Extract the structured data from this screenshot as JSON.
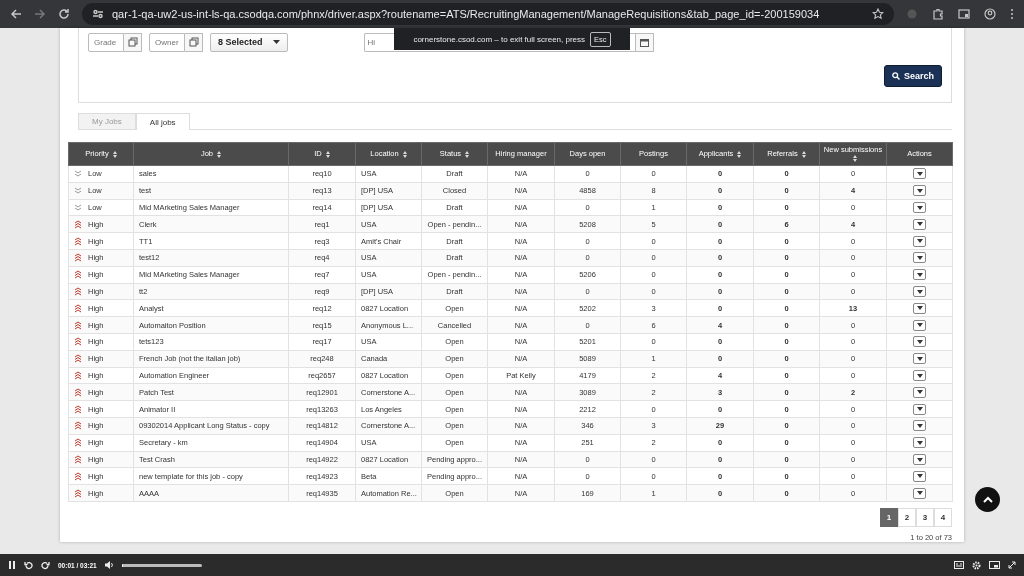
{
  "browser": {
    "url": "qar-1-qa-uw2-us-int-ls-qa.csodqa.com/phnx/driver.aspx?routename=ATS/RecruitingManagement/ManageRequisitions&tab_page_id=-200159034"
  },
  "fullscreen_notice": {
    "text": "cornerstone.csod.com – to exit full screen, press",
    "key": "Esc"
  },
  "filters": {
    "grade": {
      "placeholder": "Grade"
    },
    "owner": {
      "placeholder": "Owner"
    },
    "status_dropdown": "8 Selected",
    "hiring_field": {
      "placeholder": "Hi"
    },
    "search_button": "Search"
  },
  "tabs": [
    {
      "label": "My Jobs",
      "selected": false
    },
    {
      "label": "All jobs",
      "selected": true
    }
  ],
  "table": {
    "columns": [
      {
        "label": "Priority",
        "sortable": true
      },
      {
        "label": "Job",
        "sortable": true
      },
      {
        "label": "ID",
        "sortable": true
      },
      {
        "label": "Location",
        "sortable": true
      },
      {
        "label": "Status",
        "sortable": true
      },
      {
        "label": "Hiring manager",
        "sortable": false
      },
      {
        "label": "Days open",
        "sortable": false
      },
      {
        "label": "Postings",
        "sortable": false
      },
      {
        "label": "Applicants",
        "sortable": true
      },
      {
        "label": "Referrals",
        "sortable": true
      },
      {
        "label": "New submissions",
        "sortable": true
      },
      {
        "label": "Actions",
        "sortable": false
      }
    ],
    "rows": [
      {
        "priority": "Low",
        "kind": "low",
        "job": "sales",
        "id": "req10",
        "location": "USA",
        "status": "Draft",
        "hiring_manager": "N/A",
        "days_open": "0",
        "postings": "0",
        "applicants": "0",
        "referrals": "0",
        "new_submissions": "0",
        "new_submissions_bold": false
      },
      {
        "priority": "Low",
        "kind": "low",
        "job": "test",
        "id": "req13",
        "location": "[DP] USA",
        "status": "Closed",
        "hiring_manager": "N/A",
        "days_open": "4858",
        "postings": "8",
        "applicants": "0",
        "referrals": "0",
        "new_submissions": "4",
        "new_submissions_bold": true
      },
      {
        "priority": "Low",
        "kind": "low",
        "job": "Mid MArketing Sales Manager",
        "id": "req14",
        "location": "[DP] USA",
        "status": "Draft",
        "hiring_manager": "N/A",
        "days_open": "0",
        "postings": "1",
        "applicants": "0",
        "referrals": "0",
        "new_submissions": "0",
        "new_submissions_bold": false
      },
      {
        "priority": "High",
        "kind": "high",
        "job": "Clerk",
        "id": "req1",
        "location": "USA",
        "status": "Open - pendin...",
        "hiring_manager": "N/A",
        "days_open": "5208",
        "postings": "5",
        "applicants": "0",
        "referrals": "6",
        "new_submissions": "4",
        "new_submissions_bold": true
      },
      {
        "priority": "High",
        "kind": "high",
        "job": "TT1",
        "id": "req3",
        "location": "Amit's Chair",
        "status": "Draft",
        "hiring_manager": "N/A",
        "days_open": "0",
        "postings": "0",
        "applicants": "0",
        "referrals": "0",
        "new_submissions": "0",
        "new_submissions_bold": false
      },
      {
        "priority": "High",
        "kind": "high",
        "job": "test12",
        "id": "req4",
        "location": "USA",
        "status": "Draft",
        "hiring_manager": "N/A",
        "days_open": "0",
        "postings": "0",
        "applicants": "0",
        "referrals": "0",
        "new_submissions": "0",
        "new_submissions_bold": false
      },
      {
        "priority": "High",
        "kind": "high",
        "job": "Mid MArketing Sales Manager",
        "id": "req7",
        "location": "USA",
        "status": "Open - pendin...",
        "hiring_manager": "N/A",
        "days_open": "5206",
        "postings": "0",
        "applicants": "0",
        "referrals": "0",
        "new_submissions": "0",
        "new_submissions_bold": false
      },
      {
        "priority": "High",
        "kind": "high",
        "job": "tt2",
        "id": "req9",
        "location": "[DP] USA",
        "status": "Draft",
        "hiring_manager": "N/A",
        "days_open": "0",
        "postings": "0",
        "applicants": "0",
        "referrals": "0",
        "new_submissions": "0",
        "new_submissions_bold": false
      },
      {
        "priority": "High",
        "kind": "high",
        "job": "Analyst",
        "id": "req12",
        "location": "0827 Location",
        "status": "Open",
        "hiring_manager": "N/A",
        "days_open": "5202",
        "postings": "3",
        "applicants": "0",
        "referrals": "0",
        "new_submissions": "13",
        "new_submissions_bold": true
      },
      {
        "priority": "High",
        "kind": "high",
        "job": "Automaiton Position",
        "id": "req15",
        "location": "Anonymous L...",
        "status": "Cancelled",
        "hiring_manager": "N/A",
        "days_open": "0",
        "postings": "6",
        "applicants": "4",
        "referrals": "0",
        "new_submissions": "0",
        "new_submissions_bold": false
      },
      {
        "priority": "High",
        "kind": "high",
        "job": "tets123",
        "id": "req17",
        "location": "USA",
        "status": "Open",
        "hiring_manager": "N/A",
        "days_open": "5201",
        "postings": "0",
        "applicants": "0",
        "referrals": "0",
        "new_submissions": "0",
        "new_submissions_bold": false
      },
      {
        "priority": "High",
        "kind": "high",
        "job": "French Job (not the italian job)",
        "id": "req248",
        "location": "Canada",
        "status": "Open",
        "hiring_manager": "N/A",
        "days_open": "5089",
        "postings": "1",
        "applicants": "0",
        "referrals": "0",
        "new_submissions": "0",
        "new_submissions_bold": false
      },
      {
        "priority": "High",
        "kind": "high",
        "job": "Automation Engineer",
        "id": "req2657",
        "location": "0827 Location",
        "status": "Open",
        "hiring_manager": "Pat Kelly",
        "days_open": "4179",
        "postings": "2",
        "applicants": "4",
        "referrals": "0",
        "new_submissions": "0",
        "new_submissions_bold": false
      },
      {
        "priority": "High",
        "kind": "high",
        "job": "Patch Test",
        "id": "req12901",
        "location": "Cornerstone A...",
        "status": "Open",
        "hiring_manager": "N/A",
        "days_open": "3089",
        "postings": "2",
        "applicants": "3",
        "referrals": "0",
        "new_submissions": "2",
        "new_submissions_bold": true
      },
      {
        "priority": "High",
        "kind": "high",
        "job": "Animator II",
        "id": "req13263",
        "location": "Los Angeles",
        "status": "Open",
        "hiring_manager": "N/A",
        "days_open": "2212",
        "postings": "0",
        "applicants": "0",
        "referrals": "0",
        "new_submissions": "0",
        "new_submissions_bold": false
      },
      {
        "priority": "High",
        "kind": "high",
        "job": "09302014 Applicant Long Status - copy",
        "id": "req14812",
        "location": "Cornerstone A...",
        "status": "Open",
        "hiring_manager": "N/A",
        "days_open": "346",
        "postings": "3",
        "applicants": "29",
        "referrals": "0",
        "new_submissions": "0",
        "new_submissions_bold": false
      },
      {
        "priority": "High",
        "kind": "high",
        "job": "Secretary - km",
        "id": "req14904",
        "location": "USA",
        "status": "Open",
        "hiring_manager": "N/A",
        "days_open": "251",
        "postings": "2",
        "applicants": "0",
        "referrals": "0",
        "new_submissions": "0",
        "new_submissions_bold": false
      },
      {
        "priority": "High",
        "kind": "high",
        "job": "Test Crash",
        "id": "req14922",
        "location": "0827 Location",
        "status": "Pending appro...",
        "hiring_manager": "N/A",
        "days_open": "0",
        "postings": "0",
        "applicants": "0",
        "referrals": "0",
        "new_submissions": "0",
        "new_submissions_bold": false
      },
      {
        "priority": "High",
        "kind": "high",
        "job": "new template for this job - copy",
        "id": "req14923",
        "location": "Beta",
        "status": "Pending appro...",
        "hiring_manager": "N/A",
        "days_open": "0",
        "postings": "0",
        "applicants": "0",
        "referrals": "0",
        "new_submissions": "0",
        "new_submissions_bold": false
      },
      {
        "priority": "High",
        "kind": "high",
        "job": "AAAA",
        "id": "req14935",
        "location": "Automation Re...",
        "status": "Open",
        "hiring_manager": "N/A",
        "days_open": "169",
        "postings": "1",
        "applicants": "0",
        "referrals": "0",
        "new_submissions": "0",
        "new_submissions_bold": false
      }
    ]
  },
  "pagination": {
    "pages": [
      {
        "label": "1",
        "selected": true
      },
      {
        "label": "2",
        "selected": false
      },
      {
        "label": "3",
        "selected": false
      },
      {
        "label": "4",
        "selected": false
      }
    ],
    "summary": "1 to 20 of 73"
  },
  "player": {
    "time": "00:01 / 03:21",
    "level": 0.01
  }
}
